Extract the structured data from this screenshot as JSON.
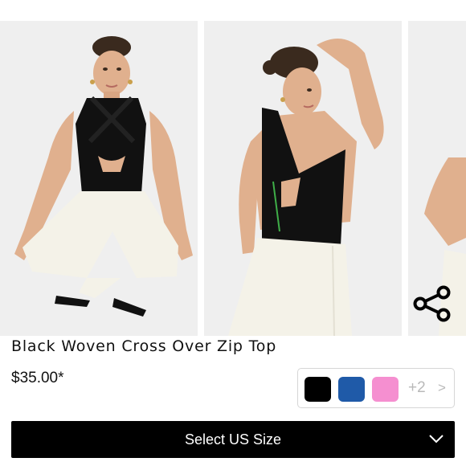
{
  "product": {
    "title": "Black Woven Cross Over Zip Top",
    "price": "$35.00*"
  },
  "gallery": {
    "images": [
      {
        "name": "front view"
      },
      {
        "name": "back view"
      },
      {
        "name": "side view"
      }
    ],
    "share_icon": "share-icon"
  },
  "colors": {
    "swatches": [
      "#000000",
      "#1f5aa8",
      "#f58fd0"
    ],
    "more_label": "+2",
    "more_arrow": ">"
  },
  "size_selector": {
    "label": "Select US Size",
    "icon": "chevron-down-icon"
  },
  "theme": {
    "button_bg": "#000000",
    "button_text": "#ffffff",
    "image_bg": "#efefef"
  }
}
